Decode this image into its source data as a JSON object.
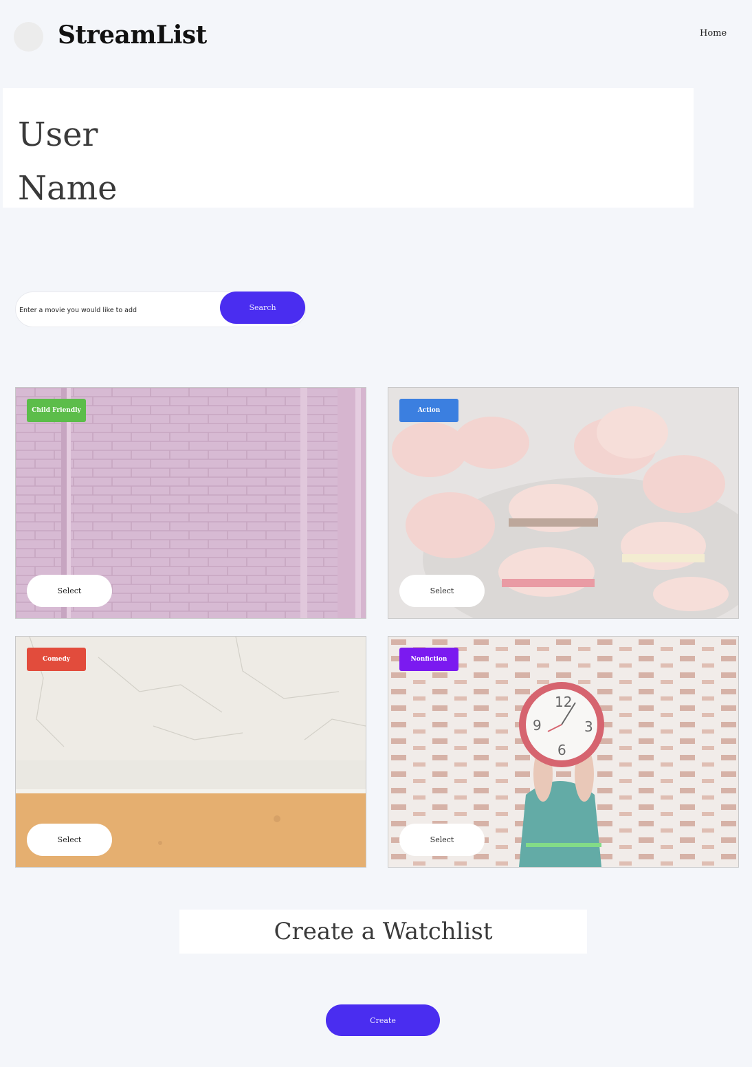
{
  "header": {
    "brand": "StreamList",
    "nav_home": "Home"
  },
  "profile": {
    "line1": "User",
    "line2": "Name"
  },
  "search": {
    "placeholder": "Enter a movie you would like to add",
    "button_label": "Search"
  },
  "cards": [
    {
      "tag": "Child Friendly",
      "tag_color": "#5cbd4a",
      "button_label": "Select"
    },
    {
      "tag": "Action",
      "tag_color": "#3b7fe0",
      "button_label": "Select"
    },
    {
      "tag": "Comedy",
      "tag_color": "#e24c3c",
      "button_label": "Select"
    },
    {
      "tag": "Nonfiction",
      "tag_color": "#7b1af0",
      "button_label": "Select"
    }
  ],
  "watchlist": {
    "heading": "Create a Watchlist",
    "button_label": "Create"
  },
  "theme": {
    "accent": "#4a2df0",
    "background": "#f4f6fa"
  }
}
